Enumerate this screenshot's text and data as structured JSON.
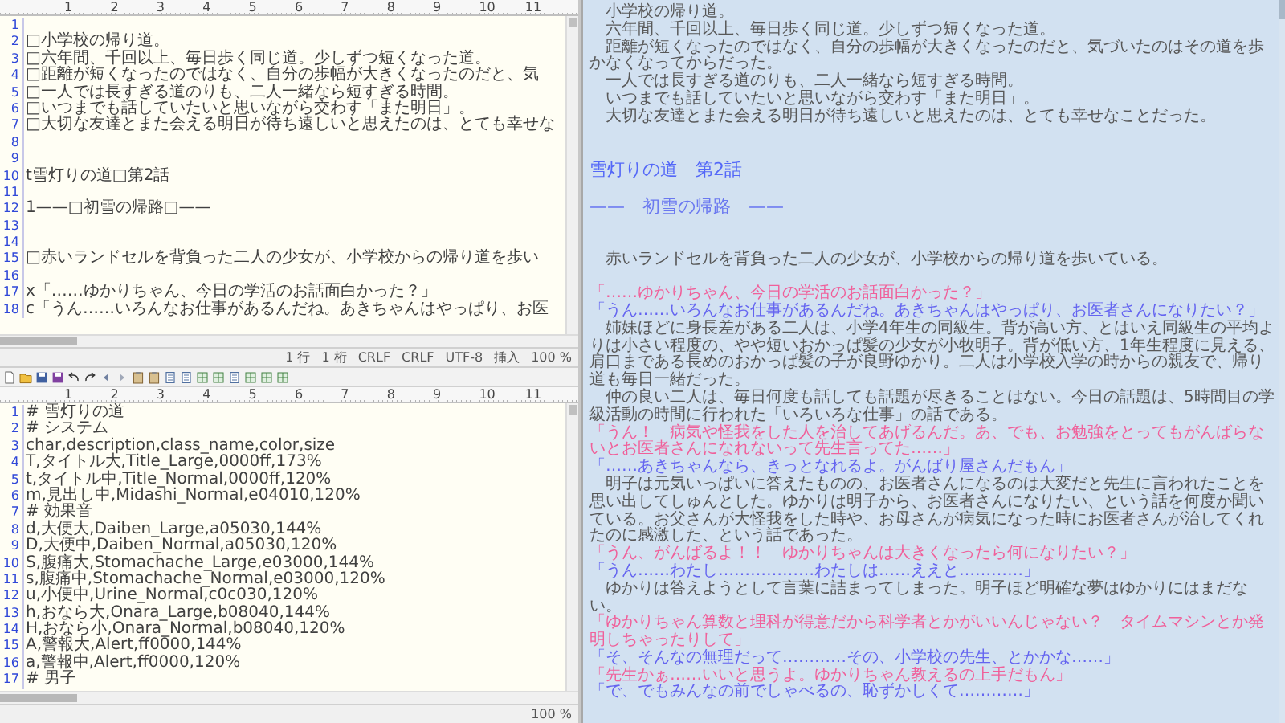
{
  "editor_top": {
    "ruler": [
      "1",
      "2",
      "3",
      "4",
      "5",
      "6",
      "7",
      "8",
      "9",
      "10",
      "11"
    ],
    "lines": [
      {
        "num": "1"
      },
      {
        "num": "2",
        "text": "□小学校の帰り道。"
      },
      {
        "num": "3",
        "text": "□六年間、千回以上、毎日歩く同じ道。少しずつ短くなった道。"
      },
      {
        "num": "4",
        "text": "□距離が短くなったのではなく、自分の歩幅が大きくなったのだと、気"
      },
      {
        "num": "5",
        "text": "□一人では長すぎる道のりも、二人一緒なら短すぎる時間。"
      },
      {
        "num": "6",
        "text": "□いつまでも話していたいと思いながら交わす「また明日」。"
      },
      {
        "num": "7",
        "text": "□大切な友達とまた会える明日が待ち遠しいと思えたのは、とても幸せな"
      },
      {
        "num": "8"
      },
      {
        "num": "9"
      },
      {
        "num": "10",
        "text": "t雪灯りの道□第2話"
      },
      {
        "num": "11"
      },
      {
        "num": "12",
        "text": "1——□初雪の帰路□——"
      },
      {
        "num": "13"
      },
      {
        "num": "14"
      },
      {
        "num": "15",
        "text": "□赤いランドセルを背負った二人の少女が、小学校からの帰り道を歩い"
      },
      {
        "num": "16"
      },
      {
        "num": "17",
        "text": "x「……ゆかりちゃん、今日の学活のお話面白かった？」"
      },
      {
        "num": "18",
        "text": "c「うん……いろんなお仕事があるんだね。あきちゃんはやっぱり、お医"
      }
    ],
    "status_bar": [
      "1 行",
      "1 桁",
      "CRLF",
      "CRLF",
      "UTF-8",
      "挿入",
      "100 %"
    ]
  },
  "editor_bottom": {
    "ruler": [
      "1",
      "2",
      "3",
      "4",
      "5",
      "6",
      "7",
      "8",
      "9",
      "10",
      "11"
    ],
    "lines": [
      {
        "num": "1",
        "text": "# 雪灯りの道"
      },
      {
        "num": "2",
        "text": "# システム"
      },
      {
        "num": "3",
        "text": "char,description,class_name,color,size"
      },
      {
        "num": "4",
        "text": "T,タイトル大,Title_Large,0000ff,173%"
      },
      {
        "num": "5",
        "text": "t,タイトル中,Title_Normal,0000ff,120%"
      },
      {
        "num": "6",
        "text": "m,見出し中,Midashi_Normal,e04010,120%"
      },
      {
        "num": "7",
        "text": "# 効果音"
      },
      {
        "num": "8",
        "text": "d,大便大,Daiben_Large,a05030,144%"
      },
      {
        "num": "9",
        "text": "D,大便中,Daiben_Normal,a05030,120%"
      },
      {
        "num": "10",
        "text": "S,腹痛大,Stomachache_Large,e03000,144%"
      },
      {
        "num": "11",
        "text": "s,腹痛中,Stomachache_Normal,e03000,120%"
      },
      {
        "num": "12",
        "text": "u,小便中,Urine_Normal,c0c030,120%"
      },
      {
        "num": "13",
        "text": "h,おなら大,Onara_Large,b08040,144%"
      },
      {
        "num": "14",
        "text": "H,おなら小,Onara_Normal,b08040,120%"
      },
      {
        "num": "15",
        "text": "A,警報大,Alert,ff0000,144%"
      },
      {
        "num": "16",
        "text": "a,警報中,Alert,ff0000,120%"
      },
      {
        "num": "17",
        "text": "# 男子"
      }
    ],
    "status_bar": [
      "100 %"
    ]
  },
  "preview": {
    "lines": [
      {
        "kind": "narration",
        "text": "小学校の帰り道。"
      },
      {
        "kind": "narration",
        "text": "六年間、千回以上、毎日歩く同じ道。少しずつ短くなった道。"
      },
      {
        "kind": "narration",
        "text": "距離が短くなったのではなく、自分の歩幅が大きくなったのだと、気づいたのはその道を歩かなくなってからだった。"
      },
      {
        "kind": "narration",
        "text": "一人では長すぎる道のりも、二人一緒なら短すぎる時間。"
      },
      {
        "kind": "narration",
        "text": "いつまでも話していたいと思いながら交わす「また明日」。"
      },
      {
        "kind": "narration",
        "text": "大切な友達とまた会える明日が待ち遠しいと思えたのは、とても幸せなことだった。"
      },
      {
        "kind": "blank"
      },
      {
        "kind": "blank"
      },
      {
        "kind": "title",
        "text": "雪灯りの道　第2話"
      },
      {
        "kind": "blank"
      },
      {
        "kind": "heading",
        "text": "——　初雪の帰路　——"
      },
      {
        "kind": "blank"
      },
      {
        "kind": "blank"
      },
      {
        "kind": "narration",
        "text": "赤いランドセルを背負った二人の少女が、小学校からの帰り道を歩いている。"
      },
      {
        "kind": "blank"
      },
      {
        "kind": "dialogue",
        "color": "#f0609a",
        "text": "「……ゆかりちゃん、今日の学活のお話面白かった？」"
      },
      {
        "kind": "dialogue",
        "color": "#6464f0",
        "text": "「うん……いろんなお仕事があるんだね。あきちゃんはやっぱり、お医者さんになりたい？」"
      },
      {
        "kind": "narration",
        "text": "姉妹ほどに身長差がある二人は、小学4年生の同級生。背が高い方、とはいえ同級生の平均よりは小さい程度の、やや短いおかっぱ髪の少女が小牧明子。背が低い方、1年生程度に見える、肩口まである長めのおかっぱ髪の子が良野ゆかり。二人は小学校入学の時からの親友で、帰り道も毎日一緒だった。"
      },
      {
        "kind": "narration",
        "text": "仲の良い二人は、毎日何度も話しても話題が尽きることはない。今日の話題は、5時間目の学級活動の時間に行われた「いろいろな仕事」の話である。"
      },
      {
        "kind": "dialogue",
        "color": "#f0609a",
        "text": "「うん！　病気や怪我をした人を治してあげるんだ。あ、でも、お勉強をとってもがんばらないとお医者さんになれないって先生言ってた……」"
      },
      {
        "kind": "dialogue",
        "color": "#6464f0",
        "text": "「……あきちゃんなら、きっとなれるよ。がんばり屋さんだもん」"
      },
      {
        "kind": "narration",
        "text": "明子は元気いっぱいに答えたものの、お医者さんになるのは大変だと先生に言われたことを思い出してしゅんとした。ゆかりは明子から、お医者さんになりたい、という話を何度か聞いている。お父さんが大怪我をした時や、お母さんが病気になった時にお医者さんが治してくれたのに感激した、という話であった。"
      },
      {
        "kind": "dialogue",
        "color": "#f0609a",
        "text": "「うん、がんばるよ！！　ゆかりちゃんは大きくなったら何になりたい？」"
      },
      {
        "kind": "dialogue",
        "color": "#6464f0",
        "text": "「うん……わたし………………わたしは……ええと…………」"
      },
      {
        "kind": "narration",
        "text": "ゆかりは答えようとして言葉に詰まってしまった。明子ほど明確な夢はゆかりにはまだない。"
      },
      {
        "kind": "dialogue",
        "color": "#f0609a",
        "text": "「ゆかりちゃん算数と理科が得意だから科学者とかがいいんじゃない？　タイムマシンとか発明しちゃったりして」"
      },
      {
        "kind": "dialogue",
        "color": "#6464f0",
        "text": "「そ、そんなの無理だって…………その、小学校の先生、とかかな……」"
      },
      {
        "kind": "dialogue",
        "color": "#f0609a",
        "text": "「先生かぁ……いいと思うよ。ゆかりちゃん教えるの上手だもん」"
      },
      {
        "kind": "dialogue",
        "color": "#6464f0",
        "text": "「で、でもみんなの前でしゃべるの、恥ずかしくて…………」"
      }
    ]
  }
}
